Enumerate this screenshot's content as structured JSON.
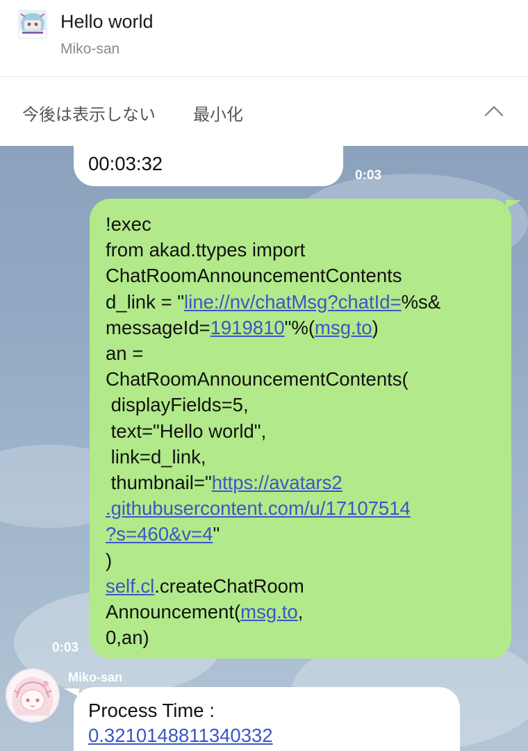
{
  "announcement": {
    "title": "Hello world",
    "author": "Miko-san",
    "thumbnail_icon": "chino-thumbnail-icon",
    "hide_label": "今後は表示しない",
    "minimize_label": "最小化",
    "collapse_icon": "chevron-up-icon"
  },
  "chat": {
    "prev_message": {
      "text": "00:03:32",
      "time": "0:03"
    },
    "sent_message": {
      "time": "0:03",
      "l01": "!exec",
      "l02": "from akad.ttypes import",
      "l03": "ChatRoomAnnouncementContents",
      "l04a": "d_link = \"",
      "l04b": "line://nv/chatMsg?chatId=",
      "l04c": "%s&",
      "l05a": "messageId=",
      "l05b": "1919810",
      "l05c": "\"%(",
      "l05d": "msg.to",
      "l05e": ")",
      "l06": "an =",
      "l07": "ChatRoomAnnouncementContents(",
      "l08": " displayFields=5,",
      "l09": " text=\"Hello world\",",
      "l10": " link=d_link,",
      "l11a": " thumbnail=\"",
      "l11b": "https://avatars2",
      "l12": ".githubusercontent.com/u/17107514",
      "l13a": "?s=460&v=4",
      "l13b": "\"",
      "l14": ")",
      "l15a": "self.cl",
      "l15b": ".createChatRoom",
      "l16a": "Announcement(",
      "l16b": "msg.to",
      "l16c": ",",
      "l17": "0,an)"
    },
    "reply": {
      "sender": "Miko-san",
      "label": "Process Time :",
      "value": "0.3210148811340332"
    }
  },
  "colors": {
    "sent_bubble": "#b2e98a",
    "link": "#3a57c4",
    "chat_bg": "#93aac4"
  }
}
